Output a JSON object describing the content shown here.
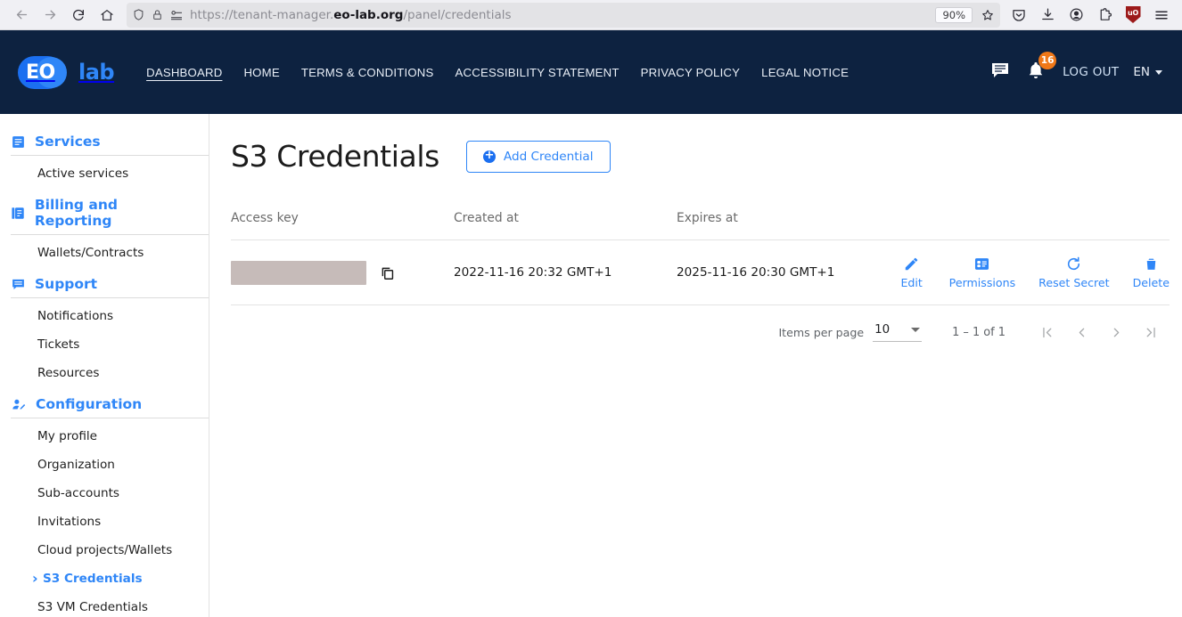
{
  "browser": {
    "back_icon": "back-arrow",
    "forward_icon": "forward-arrow",
    "reload_icon": "reload",
    "home_icon": "home",
    "shield_icon": "tracking-protection-shield",
    "lock_icon": "padlock",
    "permissions_icon": "site-permissions",
    "url_prefix": "https://tenant-manager.",
    "url_domain": "eo-lab.org",
    "url_suffix": "/panel/credentials",
    "zoom_level": "90%",
    "bookmark_icon": "star",
    "toolbar_icons": [
      "pocket-save-icon",
      "downloads-icon",
      "account-icon",
      "extensions-icon",
      "ublock-origin-icon",
      "app-menu-icon"
    ],
    "ublock_label": "uO"
  },
  "header": {
    "logo_primary": "EO",
    "logo_secondary": "lab",
    "nav": [
      {
        "label": "DASHBOARD",
        "active": true
      },
      {
        "label": "HOME",
        "active": false
      },
      {
        "label": "TERMS & CONDITIONS",
        "active": false
      },
      {
        "label": "ACCESSIBILITY STATEMENT",
        "active": false
      },
      {
        "label": "PRIVACY POLICY",
        "active": false
      },
      {
        "label": "LEGAL NOTICE",
        "active": false
      }
    ],
    "chat_icon": "chat-bubble-icon",
    "bell_icon": "notification-bell-icon",
    "notification_count": "16",
    "logout_label": "LOG OUT",
    "language": "EN"
  },
  "sidebar": {
    "groups": [
      {
        "title": "Services",
        "icon": "list-box-icon",
        "items": [
          {
            "label": "Active services",
            "active": false
          }
        ]
      },
      {
        "title": "Billing and Reporting",
        "icon": "library-books-icon",
        "items": [
          {
            "label": "Wallets/Contracts",
            "active": false
          }
        ]
      },
      {
        "title": "Support",
        "icon": "chat-support-icon",
        "items": [
          {
            "label": "Notifications",
            "active": false
          },
          {
            "label": "Tickets",
            "active": false
          },
          {
            "label": "Resources",
            "active": false
          }
        ]
      },
      {
        "title": "Configuration",
        "icon": "manage-accounts-icon",
        "items": [
          {
            "label": "My profile",
            "active": false
          },
          {
            "label": "Organization",
            "active": false
          },
          {
            "label": "Sub-accounts",
            "active": false
          },
          {
            "label": "Invitations",
            "active": false
          },
          {
            "label": "Cloud projects/Wallets",
            "active": false
          },
          {
            "label": "S3 Credentials",
            "active": true
          },
          {
            "label": "S3 VM Credentials",
            "active": false
          }
        ]
      }
    ]
  },
  "main": {
    "page_title": "S3 Credentials",
    "add_button": {
      "label": "Add Credential",
      "icon": "plus-circle-icon"
    },
    "table": {
      "columns": [
        "Access key",
        "Created at",
        "Expires at",
        ""
      ],
      "rows": [
        {
          "access_key": "",
          "access_key_redacted": true,
          "copy_icon": "copy-icon",
          "created_at": "2022-11-16 20:32 GMT+1",
          "expires_at": "2025-11-16 20:30 GMT+1",
          "actions": [
            {
              "label": "Edit",
              "icon": "pencil-icon"
            },
            {
              "label": "Permissions",
              "icon": "permissions-list-icon"
            },
            {
              "label": "Reset Secret",
              "icon": "refresh-icon"
            },
            {
              "label": "Delete",
              "icon": "trash-icon"
            }
          ]
        }
      ]
    },
    "paginator": {
      "items_per_page_label": "Items per page",
      "items_per_page_value": "10",
      "range_label": "1 – 1 of 1",
      "first_page_icon": "first-page-icon",
      "prev_page_icon": "previous-page-icon",
      "next_page_icon": "next-page-icon",
      "last_page_icon": "last-page-icon"
    }
  },
  "colors": {
    "header_bg": "#0d2240",
    "accent_blue": "#2f86f7",
    "badge_orange": "#f07818",
    "redaction": "#c6bbb9"
  }
}
